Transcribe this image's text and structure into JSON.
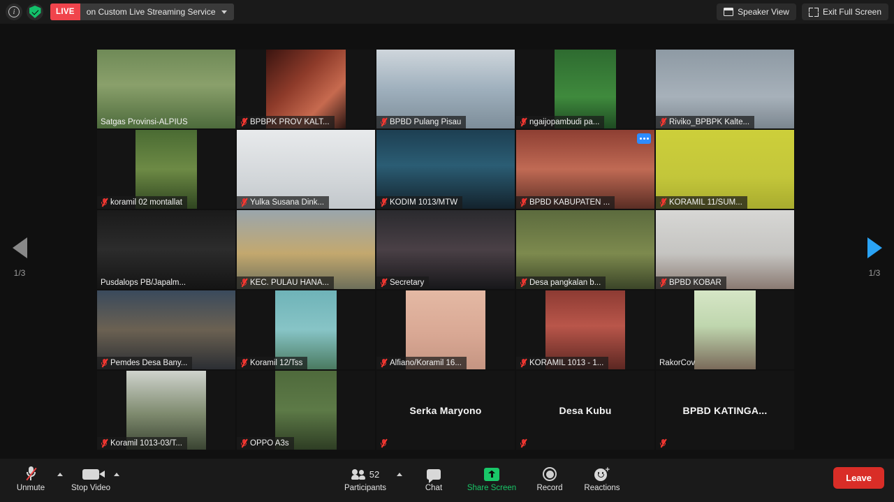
{
  "topbar": {
    "info_icon": "info-icon",
    "shield_icon": "encryption-shield-icon",
    "live_badge": "LIVE",
    "live_text": "on Custom Live Streaming Service",
    "dropdown_icon": "chevron-down-icon",
    "speaker_view": "Speaker View",
    "speaker_view_icon": "speaker-view-icon",
    "exit_full_screen": "Exit Full Screen",
    "exit_full_screen_icon": "exit-fullscreen-icon"
  },
  "pager": {
    "prev_icon": "chevron-left-icon",
    "next_icon": "chevron-right-icon",
    "left_label": "1/3",
    "right_label": "1/3",
    "prev_color": "#888888",
    "next_color": "#2aa3f5"
  },
  "grid": {
    "columns": 5,
    "rows": 5,
    "active_border_color": "#e8d300",
    "tiles": [
      {
        "name": "Satgas Provinsi-ALPIUS",
        "muted": false,
        "video": true,
        "active": true,
        "bg": "linear-gradient(180deg,#6f8a57 0%,#8aa06b 45%,#4d6b3c 100%)",
        "fit": "full",
        "label_style": "bare"
      },
      {
        "name": "BPBPK PROV KALT...",
        "muted": true,
        "video": true,
        "bg": "linear-gradient(135deg,#3a1410 0%,#8e3b2a 40%,#c76a4f 70%,#2a1512 100%)",
        "fit": "narrow2"
      },
      {
        "name": "BPBD Pulang Pisau",
        "muted": true,
        "video": true,
        "bg": "linear-gradient(180deg,#cfd6dc 0%,#9fb0bd 50%,#7d8d99 100%)",
        "fit": "full"
      },
      {
        "name": "ngaijopambudi pa...",
        "muted": true,
        "video": true,
        "bg": "linear-gradient(180deg,#2e6b30 0%,#3f8a3d 60%,#1e4a22 100%)",
        "fit": "narrow"
      },
      {
        "name": "Riviko_BPBPK Kalte...",
        "muted": true,
        "video": true,
        "bg": "linear-gradient(180deg,#8e9aa4 0%,#a7b1ba 60%,#7b868f 100%)",
        "fit": "full"
      },
      {
        "name": "koramil 02 montallat",
        "muted": true,
        "video": true,
        "bg": "linear-gradient(180deg,#4a6b33 0%,#6d8a45 50%,#2f4520 100%)",
        "fit": "narrow"
      },
      {
        "name": "Yulka Susana Dink...",
        "muted": true,
        "video": true,
        "bg": "linear-gradient(180deg,#e8eaec 0%,#d3d7da 60%,#c2c7cb 100%)",
        "fit": "full"
      },
      {
        "name": "KODIM 1013/MTW",
        "muted": true,
        "video": true,
        "bg": "linear-gradient(180deg,#1d3f52 0%,#2b5d74 45%,#13222c 100%)",
        "fit": "full"
      },
      {
        "name": "BPBD KABUPATEN ...",
        "muted": true,
        "video": true,
        "more": true,
        "bg": "linear-gradient(180deg,#8e3f33 0%,#c06a54 50%,#5a2d24 100%)",
        "fit": "full"
      },
      {
        "name": "KORAMIL 11/SUM...",
        "muted": true,
        "video": true,
        "bg": "linear-gradient(180deg,#cdcf3a 0%,#c3c63a 60%,#a8ab2e 100%)",
        "fit": "full"
      },
      {
        "name": "Pusdalops PB/Japalm...",
        "muted": false,
        "video": true,
        "bg": "linear-gradient(180deg,#1a1a1a 0%,#2c2c2c 50%,#141414 100%)",
        "fit": "full",
        "label_style": "bare"
      },
      {
        "name": "KEC. PULAU HANA...",
        "muted": true,
        "video": true,
        "bg": "linear-gradient(180deg,#9aa6ad 0%,#c3a86e 55%,#6d6f5a 100%)",
        "fit": "full"
      },
      {
        "name": "Secretary",
        "muted": true,
        "video": true,
        "bg": "linear-gradient(180deg,#2a2a2e 0%,#4a4046 50%,#17171a 100%)",
        "fit": "full"
      },
      {
        "name": "Desa pangkalan b...",
        "muted": true,
        "video": true,
        "bg": "linear-gradient(180deg,#5c6b3e 0%,#7d8a4e 55%,#3b4528 100%)",
        "fit": "full"
      },
      {
        "name": "BPBD KOBAR",
        "muted": true,
        "video": true,
        "bg": "linear-gradient(180deg,#d7d7d5 0%,#c5c4c1 55%,#8a7a72 100%)",
        "fit": "full"
      },
      {
        "name": "Pemdes Desa Bany...",
        "muted": true,
        "video": true,
        "bg": "linear-gradient(180deg,#3a4a5c 0%,#6b6152 50%,#2b2e33 100%)",
        "fit": "full"
      },
      {
        "name": "Koramil 12/Tss",
        "muted": true,
        "video": true,
        "bg": "linear-gradient(180deg,#6fb3b8 0%,#87c4c6 50%,#4a7a60 100%)",
        "fit": "narrow"
      },
      {
        "name": "Alfiano/Koramil 16...",
        "muted": true,
        "video": true,
        "bg": "linear-gradient(180deg,#e4b9a4 0%,#d9a894 55%,#c59582 100%)",
        "fit": "narrow2"
      },
      {
        "name": "KORAMIL 1013 - 1...",
        "muted": true,
        "video": true,
        "bg": "linear-gradient(180deg,#8d3b33 0%,#b9564a 45%,#5c2722 100%)",
        "fit": "narrow2"
      },
      {
        "name": "RakorCov",
        "muted": false,
        "video": true,
        "bg": "linear-gradient(180deg,#d6e6c6 0%,#bfd6ae 45%,#7a6a5a 100%)",
        "fit": "narrow",
        "label_style": "bare"
      },
      {
        "name": "Koramil 1013-03/T...",
        "muted": true,
        "video": true,
        "bg": "linear-gradient(180deg,#cfd3cd 0%,#7e8a6e 55%,#3a4432 100%)",
        "fit": "narrow2"
      },
      {
        "name": "OPPO A3s",
        "muted": true,
        "video": true,
        "bg": "linear-gradient(180deg,#4f6a3c 0%,#5d7a47 50%,#2e3d24 100%)",
        "fit": "narrow"
      },
      {
        "name": "Serka Maryono",
        "muted": true,
        "video": false
      },
      {
        "name": "Desa Kubu",
        "muted": true,
        "video": false
      },
      {
        "name": "BPBD KATINGA...",
        "muted": true,
        "video": false
      }
    ]
  },
  "bottombar": {
    "mute": {
      "label": "Unmute",
      "icon": "microphone-muted-icon",
      "caret": "chevron-up-icon"
    },
    "video": {
      "label": "Stop Video",
      "icon": "camera-icon",
      "caret": "chevron-up-icon"
    },
    "participants": {
      "label": "Participants",
      "count": "52",
      "icon": "participants-icon",
      "caret": "chevron-up-icon"
    },
    "chat": {
      "label": "Chat",
      "icon": "chat-bubble-icon"
    },
    "share": {
      "label": "Share Screen",
      "icon": "share-screen-icon",
      "color": "#19c768"
    },
    "record": {
      "label": "Record",
      "icon": "record-icon"
    },
    "reactions": {
      "label": "Reactions",
      "icon": "reactions-icon"
    },
    "leave": {
      "label": "Leave",
      "color": "#d92d27"
    }
  }
}
